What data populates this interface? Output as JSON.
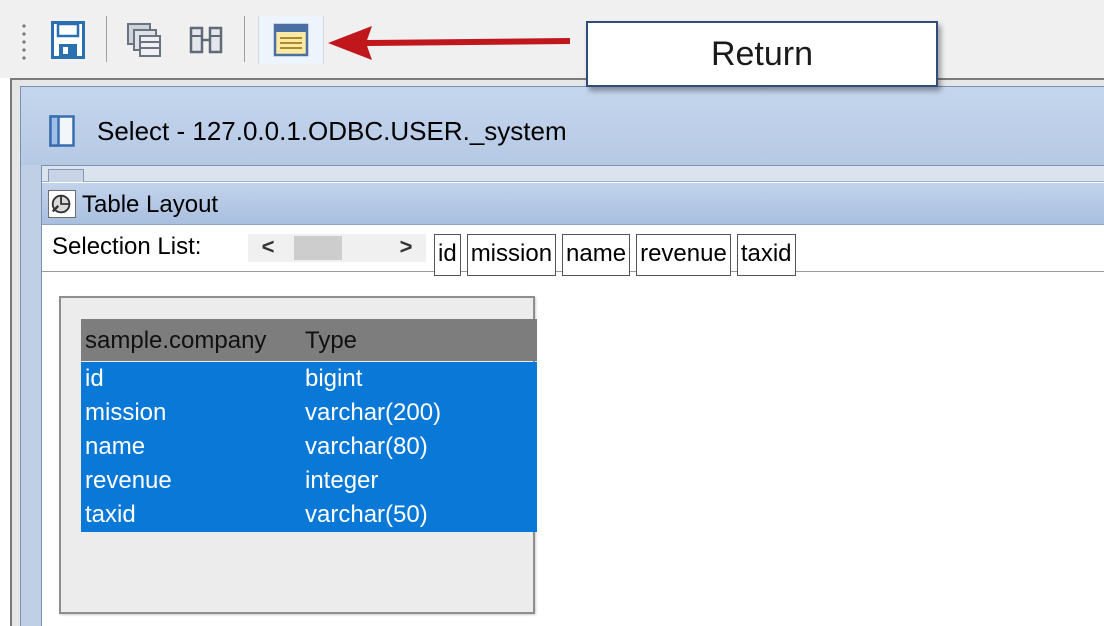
{
  "toolbar": {
    "buttons": [
      "save-icon",
      "stack-icon",
      "columns-icon",
      "list-icon"
    ]
  },
  "callout": {
    "label": "Return"
  },
  "colors": {
    "arrow": "#c0171c",
    "selection": "#0a78d7",
    "header": "#7d7d7d",
    "title_bar": "#bfcfe6"
  },
  "window": {
    "title": "Select - 127.0.0.1.ODBC.USER._system"
  },
  "table_layout": {
    "title": "Table Layout"
  },
  "selection_list": {
    "label": "Selection List:",
    "prev": "<",
    "next": ">",
    "items": [
      "id",
      "mission",
      "name",
      "revenue",
      "taxid"
    ]
  },
  "table": {
    "headers": [
      "sample.company",
      "Type"
    ],
    "rows": [
      [
        "id",
        "bigint"
      ],
      [
        "mission",
        "varchar(200)"
      ],
      [
        "name",
        "varchar(80)"
      ],
      [
        "revenue",
        "integer"
      ],
      [
        "taxid",
        "varchar(50)"
      ]
    ]
  }
}
